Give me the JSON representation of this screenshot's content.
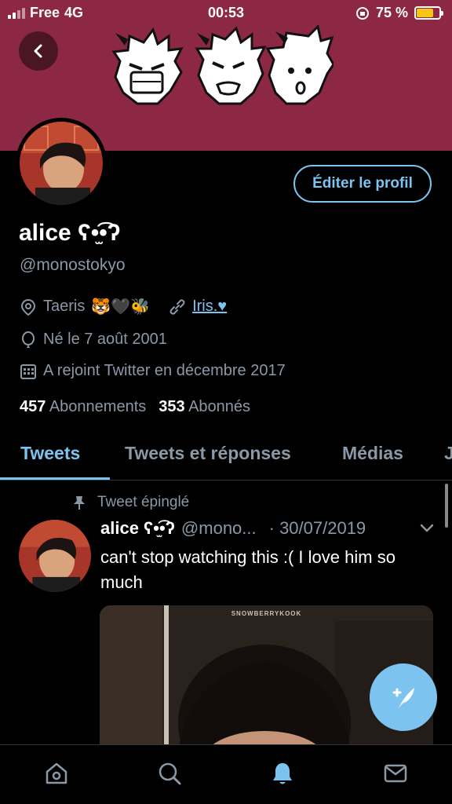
{
  "status_bar": {
    "carrier": "Free",
    "network": "4G",
    "time": "00:53",
    "battery": "75 %",
    "battery_level": 0.75
  },
  "profile": {
    "name": "alice ʕ•̫͡•ʔ",
    "handle": "@monostokyo",
    "edit_button": "Éditer le profil",
    "location": "Taeris",
    "location_emojis": "🐯🖤🐝",
    "link_text": "Iris.♥",
    "birth": "Né le 7 août 2001",
    "joined": "A rejoint Twitter en décembre 2017",
    "following_count": "457",
    "following_label": "Abonnements",
    "followers_count": "353",
    "followers_label": "Abonnés"
  },
  "tabs": [
    {
      "label": "Tweets",
      "active": true
    },
    {
      "label": "Tweets et réponses",
      "active": false
    },
    {
      "label": "Médias",
      "active": false
    },
    {
      "label": "J",
      "active": false
    }
  ],
  "tweet": {
    "pinned_label": "Tweet épinglé",
    "author_name": "alice ʕ•̫͡•ʔ",
    "author_handle": "@mono...",
    "date": "· 30/07/2019",
    "text": "can't stop watching this :( I love him so much",
    "media_watermark": "SNOWBERRYKOOK"
  },
  "colors": {
    "banner": "#8c2744",
    "accent": "#7cc3ef",
    "muted": "#8b98a5",
    "background": "#000000"
  },
  "icons": {
    "back": "chevron-left-icon",
    "location": "location-pin-icon",
    "link": "link-icon",
    "birthday": "balloon-icon",
    "calendar": "calendar-icon",
    "pin": "pin-icon",
    "caret": "chevron-down-icon",
    "compose": "compose-tweet-icon",
    "nav": [
      "home-icon",
      "search-icon",
      "notifications-icon",
      "messages-icon"
    ]
  }
}
